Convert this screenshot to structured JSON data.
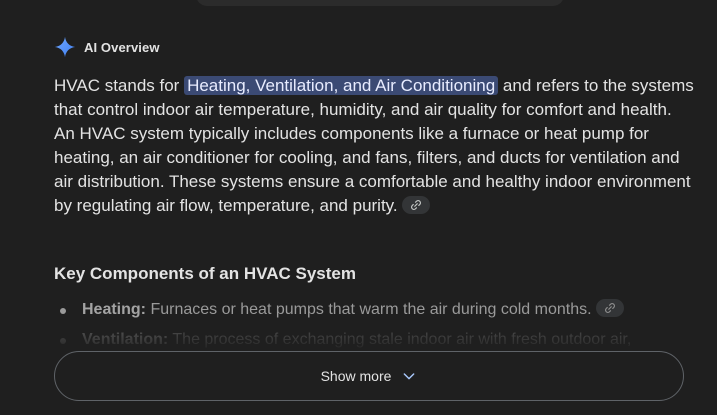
{
  "header": {
    "title": "AI Overview",
    "icon": "sparkle-icon"
  },
  "summary": {
    "before": "HVAC stands for ",
    "highlight": "Heating, Ventilation, and Air Conditioning",
    "after": " and refers to the systems that control indoor air temperature, humidity, and air quality for comfort and health. An HVAC system typically includes components like a furnace or heat pump for heating, an air conditioner for cooling, and fans, filters, and ducts for ventilation and air distribution. These systems ensure a comfortable and healthy indoor environment by regulating air flow, temperature, and purity.",
    "cite_icon": "link-icon"
  },
  "section": {
    "heading": "Key Components of an HVAC System",
    "items": [
      {
        "term": "Heating:",
        "text": " Furnaces or heat pumps that warm the air during cold months."
      },
      {
        "term": "Ventilation:",
        "text": " The process of exchanging stale indoor air with fresh outdoor air,"
      }
    ]
  },
  "show_more": {
    "label": "Show more",
    "icon": "chevron-down-icon"
  },
  "colors": {
    "background": "#1f1f1f",
    "highlight": "#3b4a74",
    "text": "#e3e3e3",
    "sparkle_blue": "#4f8ff7"
  }
}
